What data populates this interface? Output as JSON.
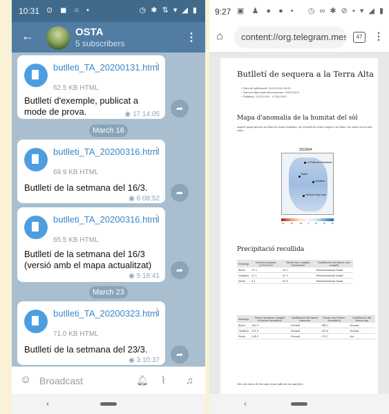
{
  "left": {
    "status": {
      "time": "10:31",
      "icons": "⊙ ◼ ○ •",
      "right": "◷ ✱ ⇅ ▾ ◢ ▮"
    },
    "header": {
      "title": "OSTA",
      "subtitle": "5 subscribers"
    },
    "messages": [
      {
        "file": "butlleti_TA_20200131.html",
        "size": "62.5 KB HTML",
        "text": "Butlletí d'exemple, publicat a mode de prova.",
        "views": "17",
        "time": "14:05"
      },
      {
        "file": "butlleti_TA_20200316.html",
        "size": "69.9 KB HTML",
        "text": "Butlletí de la setmana del 16/3.",
        "views": "6",
        "time": "08:52"
      },
      {
        "file": "butlleti_TA_20200316.html",
        "size": "65.5 KB HTML",
        "text": "Butlletí de la setmana del 16/3 (versió amb el mapa actualitzat)",
        "views": "5",
        "time": "18:41"
      },
      {
        "file": "butlleti_TA_20200323.html",
        "size": "71.0 KB HTML",
        "text": "Butlletí de la setmana del 23/3.",
        "views": "3",
        "time": "10:37"
      }
    ],
    "dates": [
      "March 16",
      "March 23"
    ],
    "input": {
      "placeholder": "Broadcast"
    }
  },
  "right": {
    "status": {
      "time": "9:27",
      "icons": "▣ ♟ ● ● •",
      "right": "◷ ∞ ✱ ⊘ • ▾ ◢ ▮"
    },
    "url": "content://org.telegram.mes",
    "tabs_count": "47",
    "doc": {
      "title": "Butlletí de sequera a la Terra Alta",
      "meta": [
        "• Data de publicació: 31/01/2020 00:35",
        "• Darrera data amb observacions: 29/01/2020",
        "• Validesa: 31/01/2020 - 07/02/2020"
      ],
      "h_map": "Mapa d'anomalia de la humitat del sòl",
      "p_map": "Aquest mapa mostra en blau les zones humides, en vermell les zones seques i en blanc les zones en un bon estat.",
      "map_title": "2019W4",
      "map_labels": [
        "La Pobla de Massaluca",
        "Batea",
        "Gandesa",
        "Horta de Sant Joan"
      ],
      "cbar_labels": [
        "-60",
        "-40",
        "-20",
        "0",
        "20",
        "40",
        "60"
      ],
      "h_precip": "Precipitació recollida",
      "table1": {
        "headers": [
          "Municipi",
          "Darrera setmana (2/15/2020)",
          "Darrer mes complet (Desembre)",
          "Qualificació del darrer mes complet"
        ],
        "rows": [
          [
            "Batea",
            "31.3",
            "90.5",
            "Extremadament humit"
          ],
          [
            "Gandesa",
            "25.2",
            "92.9",
            "Extremadament humit"
          ],
          [
            "Horta",
            "8.1",
            "85.8",
            "Extremadament humit"
          ]
        ]
      },
      "table2": {
        "headers": [
          "Municipi",
          "Darrer trimestre complet (Octubre-Desembre)",
          "Qualificació del darrer trimestre",
          "Darrer any (Gener-Desembre)",
          "Qualificació del darrer any"
        ],
        "rows": [
          [
            "Batea",
            "160.9",
            "Normal",
            "344.3",
            "Normal"
          ],
          [
            "Gandesa",
            "201.8",
            "Normal",
            "380.4",
            "Normal"
          ],
          [
            "Horta",
            "204.9",
            "Normal",
            "379.7",
            "Sec"
          ]
        ]
      },
      "footnote": "Tots els valors de la taula estan indicats en mm/l/m2."
    }
  },
  "colors": {
    "tg_header": "#527da3",
    "tg_status": "#3f6a8c",
    "tg_bg": "#a9bfcf",
    "link": "#3b86c8",
    "outer": "#fbf1d6"
  }
}
